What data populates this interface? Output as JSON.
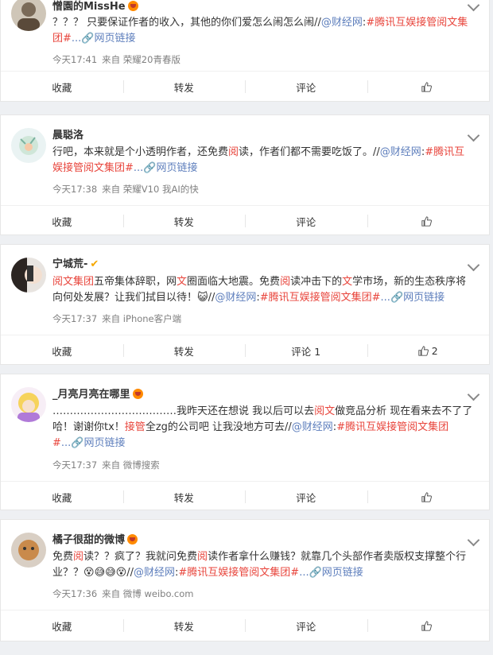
{
  "posts": [
    {
      "name": "憎園的MissHe",
      "text_parts": [
        {
          "t": "？？？ 只要保证作者的收入，其他的你们爱怎么闹怎么闹//",
          "c": ""
        },
        {
          "t": "@财经网",
          "c": "tag"
        },
        {
          "t": ":",
          "c": ""
        },
        {
          "t": "#腾讯互娱接管阅文集团#",
          "c": "hl"
        },
        {
          "t": "...",
          "c": "tag"
        },
        {
          "t": "🔗网页链接",
          "c": "tag"
        }
      ],
      "time": "今天17:41",
      "source": "来自 荣耀20青春版",
      "actions": {
        "collect": "收藏",
        "repost": "转发",
        "comment": "评论",
        "like": ""
      }
    },
    {
      "name": "晨聪洛",
      "text_parts": [
        {
          "t": "行吧，本来就是个小透明作者，还免费",
          "c": ""
        },
        {
          "t": "阅",
          "c": "hl"
        },
        {
          "t": "读，作者们都不需要吃饭了。//",
          "c": ""
        },
        {
          "t": "@财经网",
          "c": "tag"
        },
        {
          "t": ":",
          "c": ""
        },
        {
          "t": "#腾讯互娱接管阅文集团#",
          "c": "hl"
        },
        {
          "t": "...",
          "c": "tag"
        },
        {
          "t": "🔗网页链接",
          "c": "tag"
        }
      ],
      "time": "今天17:38",
      "source": "来自 荣耀V10 我AI的快",
      "actions": {
        "collect": "收藏",
        "repost": "转发",
        "comment": "评论",
        "like": ""
      }
    },
    {
      "name": "宁城荒-",
      "text_parts": [
        {
          "t": "阅文集团",
          "c": "hl"
        },
        {
          "t": "五帝集体辞职，网",
          "c": ""
        },
        {
          "t": "文",
          "c": "hl"
        },
        {
          "t": "圈面临大地震。免费",
          "c": ""
        },
        {
          "t": "阅",
          "c": "hl"
        },
        {
          "t": "读冲击下的",
          "c": ""
        },
        {
          "t": "文",
          "c": "hl"
        },
        {
          "t": "学市场，新的生态秩序将向何处发展？让我们拭目以待！",
          "c": ""
        },
        {
          "t": "😺",
          "c": ""
        },
        {
          "t": "//",
          "c": ""
        },
        {
          "t": "@财经网",
          "c": "tag"
        },
        {
          "t": ":",
          "c": ""
        },
        {
          "t": "#腾讯互娱接管阅文集团#",
          "c": "hl"
        },
        {
          "t": "...",
          "c": "tag"
        },
        {
          "t": "🔗网页链接",
          "c": "tag"
        }
      ],
      "time": "今天17:37",
      "source": "来自 iPhone客户端",
      "actions": {
        "collect": "收藏",
        "repost": "转发",
        "comment": "评论 1",
        "like": "2"
      }
    },
    {
      "name": "_月亮月亮在哪里",
      "text_parts": [
        {
          "t": "………………………………我昨天还在想说 我以后可以去",
          "c": ""
        },
        {
          "t": "阅文",
          "c": "hl"
        },
        {
          "t": "做竞品分析 现在看来去不了了哈！谢谢你tx！",
          "c": ""
        },
        {
          "t": "接管",
          "c": "hl"
        },
        {
          "t": "全zg的公司吧 让我没地方可去//",
          "c": ""
        },
        {
          "t": "@财经网",
          "c": "tag"
        },
        {
          "t": ":",
          "c": ""
        },
        {
          "t": "#腾讯互娱接管阅文集团#",
          "c": "hl"
        },
        {
          "t": "...",
          "c": "tag"
        },
        {
          "t": "🔗网页链接",
          "c": "tag"
        }
      ],
      "time": "今天17:37",
      "source": "来自 微博搜索",
      "actions": {
        "collect": "收藏",
        "repost": "转发",
        "comment": "评论",
        "like": ""
      }
    },
    {
      "name": "橘子很甜的微博",
      "text_parts": [
        {
          "t": "免费",
          "c": ""
        },
        {
          "t": "阅",
          "c": "hl"
        },
        {
          "t": "读？？疯了？我就问免费",
          "c": ""
        },
        {
          "t": "阅",
          "c": "hl"
        },
        {
          "t": "读作者拿什么赚钱？就靠几个头部作者卖版权支撑整个行业？？",
          "c": ""
        },
        {
          "t": "😵😅😅😵",
          "c": ""
        },
        {
          "t": "//",
          "c": ""
        },
        {
          "t": "@财经网",
          "c": "tag"
        },
        {
          "t": ":",
          "c": ""
        },
        {
          "t": "#腾讯互娱接管阅文集团#",
          "c": "hl"
        },
        {
          "t": "...",
          "c": "tag"
        },
        {
          "t": "🔗网页链接",
          "c": "tag"
        }
      ],
      "time": "今天17:36",
      "source": "来自 微博 weibo.com",
      "actions": {
        "collect": "收藏",
        "repost": "转发",
        "comment": "评论",
        "like": ""
      }
    }
  ]
}
